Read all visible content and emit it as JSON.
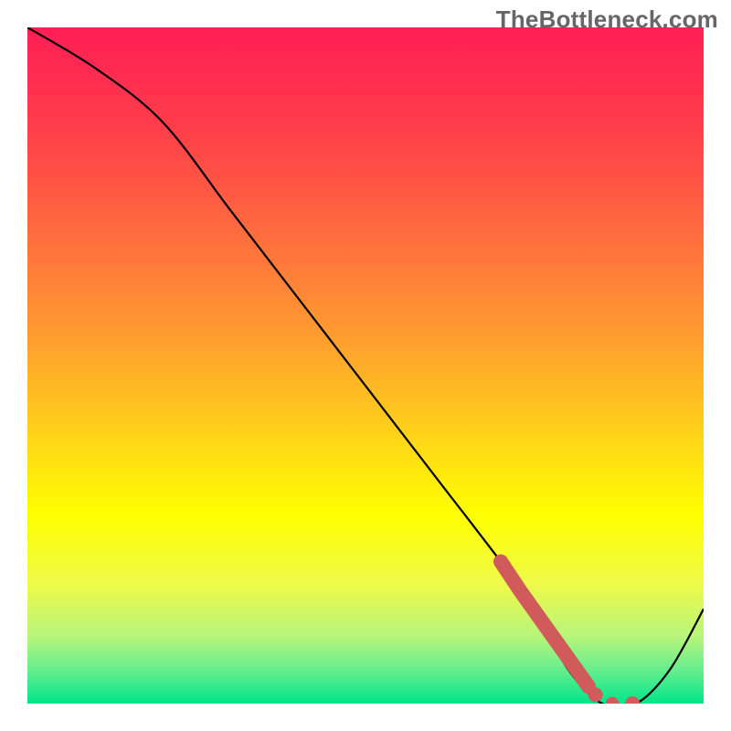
{
  "watermark": "TheBottleneck.com",
  "chart_data": {
    "type": "line",
    "title": "",
    "xlabel": "",
    "ylabel": "",
    "xlim": [
      0,
      100
    ],
    "ylim": [
      0,
      100
    ],
    "x": [
      0,
      10,
      20,
      30,
      40,
      50,
      60,
      70,
      75,
      80,
      85,
      90,
      95,
      100
    ],
    "values": [
      100,
      94,
      86,
      73,
      60,
      47,
      34,
      21,
      14,
      5,
      0,
      0,
      5,
      14
    ],
    "highlight_segment": {
      "x": [
        70,
        71,
        72,
        73,
        74,
        75,
        76,
        77,
        78,
        79,
        80,
        81,
        82,
        83,
        84,
        85,
        86,
        87,
        88,
        89,
        90
      ],
      "values": [
        21,
        19.5,
        18.0,
        16.5,
        15.1,
        13.7,
        12.3,
        10.9,
        9.5,
        8.1,
        6.7,
        5.3,
        3.9,
        2.5,
        1.3,
        0.4,
        0.1,
        0,
        0,
        0,
        0
      ],
      "color": "#d15a5a",
      "style": "dashed-thick"
    },
    "gradient": {
      "direction": "vertical",
      "stops": [
        {
          "pos": 0.0,
          "color": "#ff1e55"
        },
        {
          "pos": 0.15,
          "color": "#ff3e4a"
        },
        {
          "pos": 0.3,
          "color": "#ff6a3f"
        },
        {
          "pos": 0.45,
          "color": "#ff9a30"
        },
        {
          "pos": 0.6,
          "color": "#ffd21a"
        },
        {
          "pos": 0.72,
          "color": "#ffff00"
        },
        {
          "pos": 0.82,
          "color": "#f0fa48"
        },
        {
          "pos": 0.9,
          "color": "#b8f57a"
        },
        {
          "pos": 0.95,
          "color": "#66eE8e"
        },
        {
          "pos": 1.0,
          "color": "#00e58a"
        }
      ]
    }
  }
}
